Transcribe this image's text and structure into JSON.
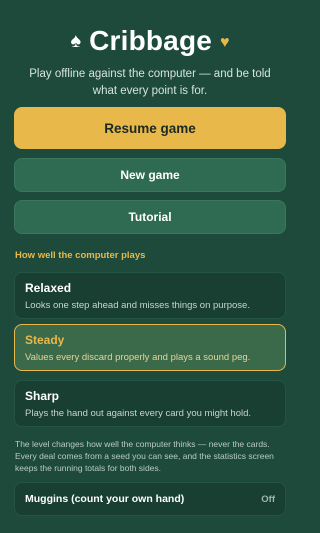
{
  "app": {
    "title": "Cribbage",
    "subtitle": "Play offline against the computer — and be told what every point is for.",
    "icons": {
      "left": "spade-icon",
      "right": "heart-icon"
    }
  },
  "actions": {
    "resume": "Resume game",
    "new_game": "New game",
    "tutorial": "Tutorial"
  },
  "difficulty": {
    "heading": "How well the computer plays",
    "selected": "Steady",
    "levels": [
      {
        "name": "Relaxed",
        "description": "Looks one step ahead and misses things on purpose."
      },
      {
        "name": "Steady",
        "description": "Values every discard properly and plays a sound peg."
      },
      {
        "name": "Sharp",
        "description": "Plays the hand out against every card you might hold."
      }
    ],
    "note": "The level changes how well the computer thinks — never the cards. Every deal comes from a seed you can see, and the statistics screen keeps the running totals for both sides."
  },
  "settings": {
    "muggins_label": "Muggins (count your own hand)",
    "muggins_value": "Off"
  },
  "colors": {
    "background": "#1d4a3a",
    "accent": "#e8b84a",
    "button": "#2f6a52",
    "card": "#183f31"
  }
}
